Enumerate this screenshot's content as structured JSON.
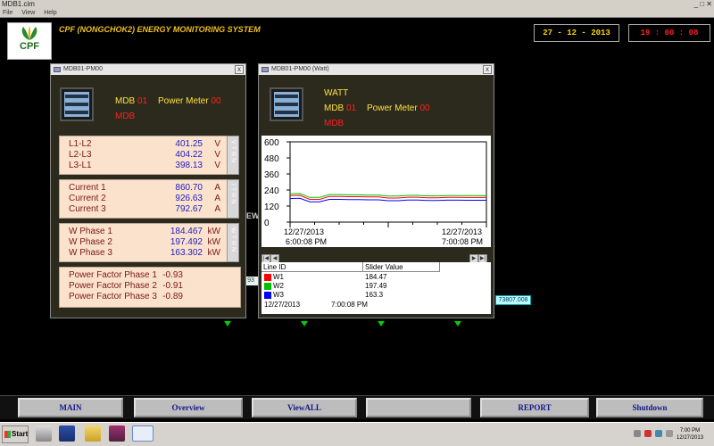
{
  "window": {
    "title": "MDB1.cim",
    "controls": "_ □ ✕"
  },
  "menu": [
    "File",
    "View",
    "Help"
  ],
  "header": {
    "brand": "CPF",
    "system_name": "CPF (NONGCHOK2) ENERGY MONITORING SYSTEM",
    "date": "27 - 12 - 2013",
    "time": "19 : 00 : 08"
  },
  "background": {
    "ew_label": "EW",
    "val1": "93",
    "val2": "73807.008"
  },
  "pm_window": {
    "title": "MDB01-PM00",
    "close": "x",
    "mdb_label": "MDB",
    "mdb_num": "01",
    "pm_label": "Power Meter",
    "pm_num": "00",
    "mdb_label2": "MDB",
    "voltage": {
      "rows": [
        {
          "label": "L1-L2",
          "value": "401.25",
          "unit": "V"
        },
        {
          "label": "L2-L3",
          "value": "404.22",
          "unit": "V"
        },
        {
          "label": "L3-L1",
          "value": "398.13",
          "unit": "V"
        }
      ],
      "side": "VTRN"
    },
    "current": {
      "rows": [
        {
          "label": "Current 1",
          "value": "860.70",
          "unit": "A"
        },
        {
          "label": "Current 2",
          "value": "926.63",
          "unit": "A"
        },
        {
          "label": "Current 3",
          "value": "792.67",
          "unit": "A"
        }
      ],
      "side": "ITRN"
    },
    "power": {
      "rows": [
        {
          "label": "W Phase 1",
          "value": "184.467",
          "unit": "kW"
        },
        {
          "label": "W Phase 2",
          "value": "197.492",
          "unit": "kW"
        },
        {
          "label": "W Phase 3",
          "value": "163.302",
          "unit": "kW"
        }
      ],
      "side": "WTRN"
    },
    "pf": {
      "rows": [
        {
          "label": "Power Factor Phase 1",
          "value": "-0.93"
        },
        {
          "label": "Power Factor Phase 2",
          "value": "-0.91"
        },
        {
          "label": "Power Factor Phase 3",
          "value": "-0.89"
        }
      ]
    }
  },
  "watt_window": {
    "title": "MDB01-PM00 (Watt)",
    "close": "x",
    "watt_label": "WATT",
    "mdb_label": "MDB",
    "mdb_num": "01",
    "pm_label": "Power Meter",
    "pm_num": "00",
    "mdb_label2": "MDB",
    "legend": {
      "col1": "Line ID",
      "col2": "Slider Value",
      "rows": [
        {
          "name": "W1",
          "value": "184.47",
          "color": "#ff0000"
        },
        {
          "name": "W2",
          "value": "197.49",
          "color": "#00c000"
        },
        {
          "name": "W3",
          "value": "163.3",
          "color": "#0000ff"
        }
      ],
      "footer_date": "12/27/2013",
      "footer_time": "7:00:08 PM"
    }
  },
  "chart_data": {
    "type": "line",
    "ylim": [
      0,
      600
    ],
    "yticks": [
      "600",
      "480",
      "360",
      "240",
      "120",
      "0"
    ],
    "x_start": {
      "date": "12/27/2013",
      "time": "6:00:08 PM"
    },
    "x_end": {
      "date": "12/27/2013",
      "time": "7:00:08 PM"
    },
    "series": [
      {
        "name": "W1",
        "color": "#ff0000",
        "values": [
          198,
          200,
          170,
          170,
          192,
          192,
          190,
          190,
          188,
          188,
          180,
          180,
          186,
          186,
          182,
          182,
          185,
          185,
          184,
          184,
          184
        ]
      },
      {
        "name": "W2",
        "color": "#00c000",
        "values": [
          212,
          214,
          185,
          185,
          206,
          206,
          204,
          204,
          202,
          202,
          195,
          195,
          200,
          200,
          196,
          196,
          199,
          199,
          198,
          198,
          197
        ]
      },
      {
        "name": "W3",
        "color": "#0000ff",
        "values": [
          176,
          178,
          152,
          152,
          170,
          170,
          168,
          168,
          167,
          167,
          160,
          160,
          165,
          165,
          162,
          162,
          164,
          164,
          163,
          163,
          163
        ]
      }
    ]
  },
  "nav": [
    "MAIN",
    "Overview",
    "ViewALL",
    "",
    "REPORT",
    "Shutdown"
  ],
  "taskbar": {
    "start": "Start",
    "clock_time": "7:00 PM",
    "clock_date": "12/27/2013"
  }
}
